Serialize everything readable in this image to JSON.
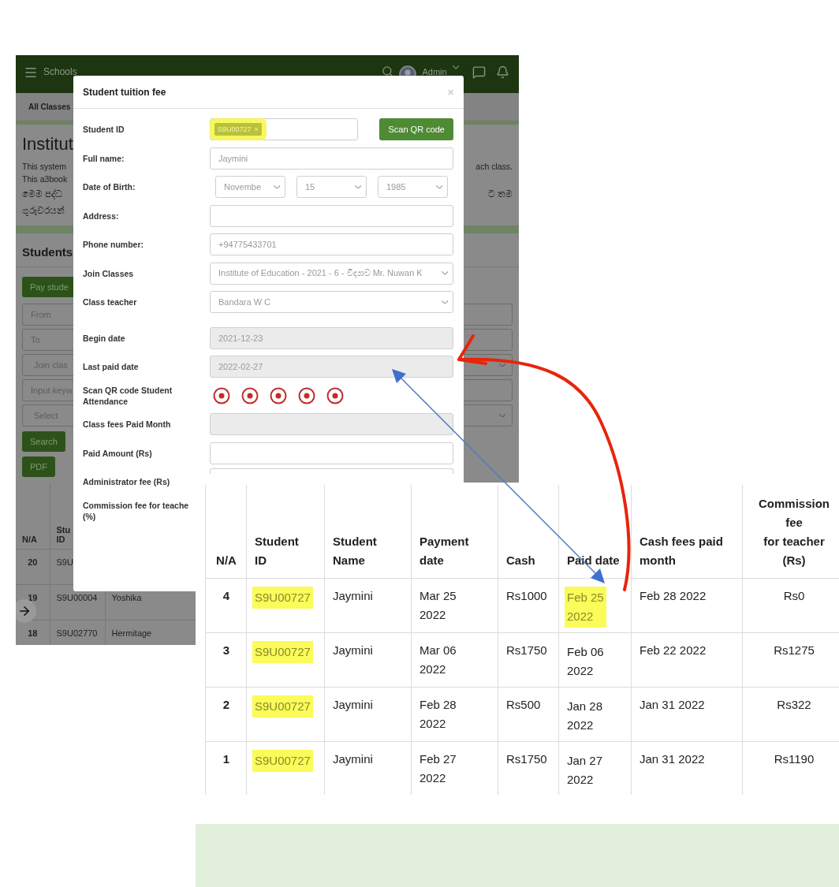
{
  "app": {
    "header": {
      "title": "Schools",
      "user": "Admin"
    },
    "breadcrumb": "All Classes",
    "heading": "Institut",
    "intro": [
      {
        "left": "This system",
        "right": "ach class."
      },
      {
        "left": "This a3book"
      },
      {
        "left": "මෙම පද්ධ",
        "right": "ට තම"
      },
      {
        "left": "ගුරුවරයන්"
      }
    ],
    "section_title": "Students",
    "pay_button": "Pay stude",
    "filters": [
      {
        "kind": "input",
        "placeholder": "From"
      },
      {
        "kind": "input",
        "placeholder": "To"
      },
      {
        "kind": "select",
        "placeholder": "Join clas"
      },
      {
        "kind": "input",
        "placeholder": "Input keyw"
      },
      {
        "kind": "select",
        "placeholder": "Select"
      }
    ],
    "search_button": "Search",
    "pdf_button": "PDF",
    "table": {
      "columns": [
        "N/A",
        "Stu\nID"
      ],
      "rows": [
        {
          "n": "20",
          "id": "S9U"
        },
        {
          "n": "19",
          "id": "S9U00004",
          "name": "Yoshika"
        },
        {
          "n": "18",
          "id": "S9U02770",
          "name": "Hermitage"
        }
      ]
    }
  },
  "modal": {
    "title": "Student tuition fee",
    "close": "×",
    "fields": [
      {
        "kind": "tags",
        "label": "Student ID",
        "tag": "S9U00727",
        "tag_remove": "×",
        "highlighted": true,
        "button": "Scan QR code"
      },
      {
        "kind": "text",
        "label": "Full name:",
        "value": "Jaymini"
      },
      {
        "kind": "date",
        "label": "Date of Birth:",
        "values": [
          "Novembe",
          "15",
          "1985"
        ]
      },
      {
        "kind": "text",
        "label": "Address:"
      },
      {
        "kind": "text",
        "label": "Phone number:",
        "value": "+94775433701"
      },
      {
        "kind": "select",
        "label": "Join Classes",
        "value": "Institute of Education - 2021 - 6 - විද්‍යාව Mr. Nuwan K"
      },
      {
        "kind": "select",
        "label": "Class teacher",
        "value": "Bandara W C"
      },
      {
        "kind": "readonly",
        "label": "Begin date",
        "value": "2021-12-23"
      },
      {
        "kind": "readonly",
        "label": "Last paid date",
        "value": "2022-02-27"
      },
      {
        "kind": "attendance",
        "label": "Scan QR code Student Attendance",
        "marks": [
          {
            "checked": true
          },
          {
            "checked": true
          },
          {
            "checked": true
          },
          {
            "checked": true
          },
          {
            "checked": true
          }
        ]
      },
      {
        "kind": "readonly",
        "label": "Class fees Paid Month"
      },
      {
        "kind": "text",
        "label": "Paid Amount (Rs)"
      },
      {
        "kind": "clipped",
        "label": "Administrator fee (Rs)"
      },
      {
        "kind": "label",
        "label": "Commission fee for teache (%)"
      }
    ]
  },
  "payments_table": {
    "columns": [
      "N/A",
      "Student\nID",
      "Student\nName",
      "Payment\ndate",
      "Cash",
      "Paid date",
      "Cash fees paid\nmonth",
      "Commission\nfee\nfor teacher\n(Rs)"
    ],
    "rows": [
      {
        "n": "4",
        "student_id": {
          "text": "S9U00727",
          "highlighted": true
        },
        "name": "Jaymini",
        "payment_date": "Mar 25\n2022",
        "cash": "Rs1000",
        "paid_date": {
          "text": "Feb 25\n2022",
          "highlighted": true
        },
        "fees_month": "Feb 28 2022",
        "commission": "Rs0"
      },
      {
        "n": "3",
        "student_id": {
          "text": "S9U00727",
          "highlighted": true
        },
        "name": "Jaymini",
        "payment_date": "Mar 06\n2022",
        "cash": "Rs1750",
        "paid_date": {
          "text": "Feb 06\n2022",
          "highlighted": false
        },
        "fees_month": "Feb 22 2022",
        "commission": "Rs1275"
      },
      {
        "n": "2",
        "student_id": {
          "text": "S9U00727",
          "highlighted": true
        },
        "name": "Jaymini",
        "payment_date": "Feb 28\n2022",
        "cash": "Rs500",
        "paid_date": {
          "text": "Jan 28\n2022",
          "highlighted": false
        },
        "fees_month": "Jan 31 2022",
        "commission": "Rs322"
      },
      {
        "n": "1",
        "student_id": {
          "text": "S9U00727",
          "highlighted": true
        },
        "name": "Jaymini",
        "payment_date": "Feb 27\n2022",
        "cash": "Rs1750",
        "paid_date": {
          "text": "Jan 27\n2022",
          "highlighted": false
        },
        "fees_month": "Jan 31 2022",
        "commission": "Rs1190"
      }
    ]
  }
}
